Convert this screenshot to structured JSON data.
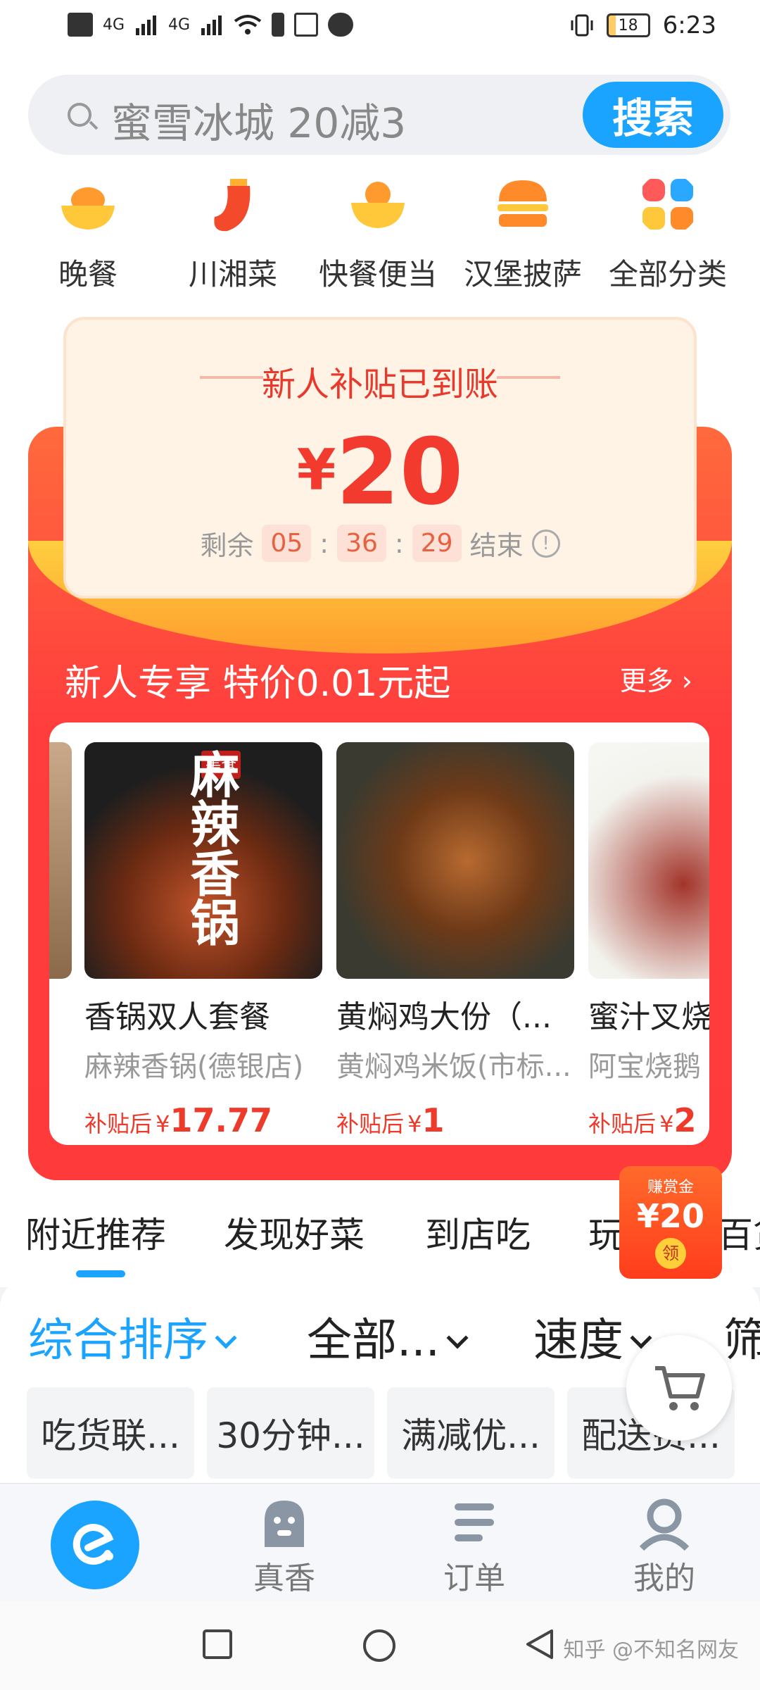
{
  "status_bar": {
    "left_icons": [
      "hd-icon",
      "signal-4g-icon",
      "signal-4g-icon",
      "wifi-icon",
      "battery-alert-icon",
      "baidu-icon",
      "wechat-icon"
    ],
    "net1": "4G",
    "net2": "4G",
    "battery": "18",
    "time": "6:23"
  },
  "search": {
    "placeholder": "蜜雪冰城 20减3",
    "button": "搜索"
  },
  "categories": [
    {
      "label": "晚餐",
      "icon": "dinner-bowl-icon",
      "color": "#ff9a2e"
    },
    {
      "label": "川湘菜",
      "icon": "chili-icon",
      "color": "#f24a2a"
    },
    {
      "label": "快餐便当",
      "icon": "fast-food-bowl-icon",
      "color": "#ffb830"
    },
    {
      "label": "汉堡披萨",
      "icon": "burger-icon",
      "color": "#ff8a2a"
    },
    {
      "label": "全部分类",
      "icon": "all-categories-icon",
      "color": "#ff6a4a"
    }
  ],
  "voucher": {
    "title": "新人补贴已到账",
    "currency": "¥",
    "amount": "20",
    "remain_label": "剩余",
    "hh": "05",
    "mm": "36",
    "ss": "29",
    "end_label": "结束",
    "sep": ":",
    "info": "!"
  },
  "newbie": {
    "title": "新人专享 特价0.01元起",
    "more": "更多"
  },
  "products": [
    {
      "name": "香锅双人套餐",
      "shop": "麻辣香锅(德银店)",
      "price_label": "补贴后",
      "currency": "¥",
      "price": "17.77",
      "img_text": "麻辣香锅",
      "img_badge": "美食"
    },
    {
      "name": "黄焖鸡大份（...",
      "shop": "黄焖鸡米饭(市标...",
      "price_label": "补贴后",
      "currency": "¥",
      "price": "1"
    },
    {
      "name": "蜜汁叉烧",
      "shop": "阿宝烧鹅",
      "price_label": "补贴后",
      "currency": "¥",
      "price": "2"
    }
  ],
  "reward": {
    "title": "赚赏金",
    "amount": "¥20",
    "claim": "领"
  },
  "tabs": [
    "附近推荐",
    "发现好菜",
    "到店吃",
    "玩",
    "百货"
  ],
  "sort": {
    "items": [
      "综合排序",
      "全部...",
      "速度",
      "筛"
    ],
    "active_index": 0,
    "chips": [
      "吃货联...",
      "30分钟...",
      "满减优...",
      "配送费..."
    ]
  },
  "bottom_nav": [
    {
      "label": "",
      "icon": "eleme-home-icon"
    },
    {
      "label": "真香",
      "icon": "ghost-face-icon"
    },
    {
      "label": "订单",
      "icon": "order-list-icon"
    },
    {
      "label": "我的",
      "icon": "profile-icon"
    }
  ],
  "system_nav": {
    "watermark": "知乎 @不知名网友"
  },
  "colors": {
    "accent": "#1aa3ff",
    "promo_red": "#ff3d3d",
    "price_red": "#ee3a2a"
  }
}
